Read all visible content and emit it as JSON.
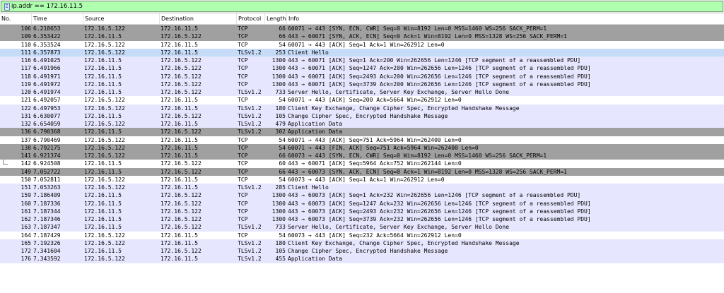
{
  "filter": {
    "value": "ip.addr == 172.16.11.5",
    "bg": "#afffaf"
  },
  "columns": {
    "no": "No.",
    "time": "Time",
    "source": "Source",
    "destination": "Destination",
    "protocol": "Protocol",
    "length": "Length",
    "info": "Info"
  },
  "colors": {
    "gray_row": "#a0a0a0",
    "purple_row": "#e7e6ff",
    "white_row": "#ffffff"
  },
  "packets": [
    {
      "no": "106",
      "time": "6.218653",
      "src": "172.16.5.122",
      "dst": "172.16.11.5",
      "proto": "TCP",
      "len": "66",
      "info": "60071 → 443 [SYN, ECN, CWR] Seq=0 Win=8192 Len=0 MSS=1460 WS=256 SACK_PERM=1",
      "style": "gray"
    },
    {
      "no": "109",
      "time": "6.353422",
      "src": "172.16.11.5",
      "dst": "172.16.5.122",
      "proto": "TCP",
      "len": "66",
      "info": "443 → 60071 [SYN, ACK, ECN] Seq=0 Ack=1 Win=8192 Len=0 MSS=1328 WS=256 SACK_PERM=1",
      "style": "gray"
    },
    {
      "no": "110",
      "time": "6.353524",
      "src": "172.16.5.122",
      "dst": "172.16.11.5",
      "proto": "TCP",
      "len": "54",
      "info": "60071 → 443 [ACK] Seq=1 Ack=1 Win=262912 Len=0",
      "style": "white"
    },
    {
      "no": "111",
      "time": "6.357873",
      "src": "172.16.5.122",
      "dst": "172.16.11.5",
      "proto": "TLSv1.2",
      "len": "253",
      "info": "Client Hello",
      "style": "sel"
    },
    {
      "no": "116",
      "time": "6.491025",
      "src": "172.16.11.5",
      "dst": "172.16.5.122",
      "proto": "TCP",
      "len": "1300",
      "info": "443 → 60071 [ACK] Seq=1 Ack=200 Win=262656 Len=1246 [TCP segment of a reassembled PDU]",
      "style": "tcp"
    },
    {
      "no": "117",
      "time": "6.491966",
      "src": "172.16.11.5",
      "dst": "172.16.5.122",
      "proto": "TCP",
      "len": "1300",
      "info": "443 → 60071 [ACK] Seq=1247 Ack=200 Win=262656 Len=1246 [TCP segment of a reassembled PDU]",
      "style": "tcp"
    },
    {
      "no": "118",
      "time": "6.491971",
      "src": "172.16.11.5",
      "dst": "172.16.5.122",
      "proto": "TCP",
      "len": "1300",
      "info": "443 → 60071 [ACK] Seq=2493 Ack=200 Win=262656 Len=1246 [TCP segment of a reassembled PDU]",
      "style": "tcp"
    },
    {
      "no": "119",
      "time": "6.491972",
      "src": "172.16.11.5",
      "dst": "172.16.5.122",
      "proto": "TCP",
      "len": "1300",
      "info": "443 → 60071 [ACK] Seq=3739 Ack=200 Win=262656 Len=1246 [TCP segment of a reassembled PDU]",
      "style": "tcp"
    },
    {
      "no": "120",
      "time": "6.491974",
      "src": "172.16.11.5",
      "dst": "172.16.5.122",
      "proto": "TLSv1.2",
      "len": "733",
      "info": "Server Hello, Certificate, Server Key Exchange, Server Hello Done",
      "style": "tls"
    },
    {
      "no": "121",
      "time": "6.492057",
      "src": "172.16.5.122",
      "dst": "172.16.11.5",
      "proto": "TCP",
      "len": "54",
      "info": "60071 → 443 [ACK] Seq=200 Ack=5664 Win=262912 Len=0",
      "style": "white"
    },
    {
      "no": "122",
      "time": "6.497953",
      "src": "172.16.5.122",
      "dst": "172.16.11.5",
      "proto": "TLSv1.2",
      "len": "180",
      "info": "Client Key Exchange, Change Cipher Spec, Encrypted Handshake Message",
      "style": "tls"
    },
    {
      "no": "131",
      "time": "6.630077",
      "src": "172.16.11.5",
      "dst": "172.16.5.122",
      "proto": "TLSv1.2",
      "len": "105",
      "info": "Change Cipher Spec, Encrypted Handshake Message",
      "style": "tls"
    },
    {
      "no": "132",
      "time": "6.654059",
      "src": "172.16.5.122",
      "dst": "172.16.11.5",
      "proto": "TLSv1.2",
      "len": "479",
      "info": "Application Data",
      "style": "tls"
    },
    {
      "no": "136",
      "time": "6.790368",
      "src": "172.16.11.5",
      "dst": "172.16.5.122",
      "proto": "TLSv1.2",
      "len": "302",
      "info": "Application Data",
      "style": "gray"
    },
    {
      "no": "137",
      "time": "6.790469",
      "src": "172.16.5.122",
      "dst": "172.16.11.5",
      "proto": "TCP",
      "len": "54",
      "info": "60071 → 443 [ACK] Seq=751 Ack=5964 Win=262400 Len=0",
      "style": "white"
    },
    {
      "no": "138",
      "time": "6.792175",
      "src": "172.16.5.122",
      "dst": "172.16.11.5",
      "proto": "TCP",
      "len": "54",
      "info": "60071 → 443 [FIN, ACK] Seq=751 Ack=5964 Win=262400 Len=0",
      "style": "gray"
    },
    {
      "no": "141",
      "time": "6.921374",
      "src": "172.16.5.122",
      "dst": "172.16.11.5",
      "proto": "TCP",
      "len": "66",
      "info": "60073 → 443 [SYN, ECN, CWR] Seq=0 Win=8192 Len=0 MSS=1460 WS=256 SACK_PERM=1",
      "style": "gray"
    },
    {
      "no": "142",
      "time": "6.924508",
      "src": "172.16.11.5",
      "dst": "172.16.5.122",
      "proto": "TCP",
      "len": "60",
      "info": "443 → 60071 [ACK] Seq=5964 Ack=752 Win=262144 Len=0",
      "style": "white",
      "tree": true
    },
    {
      "no": "149",
      "time": "7.052722",
      "src": "172.16.11.5",
      "dst": "172.16.5.122",
      "proto": "TCP",
      "len": "66",
      "info": "443 → 60073 [SYN, ACK, ECN] Seq=0 Ack=1 Win=8192 Len=0 MSS=1328 WS=256 SACK_PERM=1",
      "style": "gray"
    },
    {
      "no": "150",
      "time": "7.052811",
      "src": "172.16.5.122",
      "dst": "172.16.11.5",
      "proto": "TCP",
      "len": "54",
      "info": "60073 → 443 [ACK] Seq=1 Ack=1 Win=262912 Len=0",
      "style": "white"
    },
    {
      "no": "151",
      "time": "7.053263",
      "src": "172.16.5.122",
      "dst": "172.16.11.5",
      "proto": "TLSv1.2",
      "len": "285",
      "info": "Client Hello",
      "style": "tls"
    },
    {
      "no": "159",
      "time": "7.186409",
      "src": "172.16.11.5",
      "dst": "172.16.5.122",
      "proto": "TCP",
      "len": "1300",
      "info": "443 → 60073 [ACK] Seq=1 Ack=232 Win=262656 Len=1246 [TCP segment of a reassembled PDU]",
      "style": "tcp"
    },
    {
      "no": "160",
      "time": "7.187336",
      "src": "172.16.11.5",
      "dst": "172.16.5.122",
      "proto": "TCP",
      "len": "1300",
      "info": "443 → 60073 [ACK] Seq=1247 Ack=232 Win=262656 Len=1246 [TCP segment of a reassembled PDU]",
      "style": "tcp"
    },
    {
      "no": "161",
      "time": "7.187344",
      "src": "172.16.11.5",
      "dst": "172.16.5.122",
      "proto": "TCP",
      "len": "1300",
      "info": "443 → 60073 [ACK] Seq=2493 Ack=232 Win=262656 Len=1246 [TCP segment of a reassembled PDU]",
      "style": "tcp"
    },
    {
      "no": "162",
      "time": "7.187346",
      "src": "172.16.11.5",
      "dst": "172.16.5.122",
      "proto": "TCP",
      "len": "1300",
      "info": "443 → 60073 [ACK] Seq=3739 Ack=232 Win=262656 Len=1246 [TCP segment of a reassembled PDU]",
      "style": "tcp"
    },
    {
      "no": "163",
      "time": "7.187347",
      "src": "172.16.11.5",
      "dst": "172.16.5.122",
      "proto": "TLSv1.2",
      "len": "733",
      "info": "Server Hello, Certificate, Server Key Exchange, Server Hello Done",
      "style": "tls"
    },
    {
      "no": "164",
      "time": "7.187429",
      "src": "172.16.5.122",
      "dst": "172.16.11.5",
      "proto": "TCP",
      "len": "54",
      "info": "60073 → 443 [ACK] Seq=232 Ack=5664 Win=262912 Len=0",
      "style": "white"
    },
    {
      "no": "165",
      "time": "7.192326",
      "src": "172.16.5.122",
      "dst": "172.16.11.5",
      "proto": "TLSv1.2",
      "len": "180",
      "info": "Client Key Exchange, Change Cipher Spec, Encrypted Handshake Message",
      "style": "tls"
    },
    {
      "no": "172",
      "time": "7.341604",
      "src": "172.16.11.5",
      "dst": "172.16.5.122",
      "proto": "TLSv1.2",
      "len": "105",
      "info": "Change Cipher Spec, Encrypted Handshake Message",
      "style": "tls"
    },
    {
      "no": "176",
      "time": "7.343592",
      "src": "172.16.5.122",
      "dst": "172.16.11.5",
      "proto": "TLSv1.2",
      "len": "455",
      "info": "Application Data",
      "style": "tls"
    }
  ]
}
